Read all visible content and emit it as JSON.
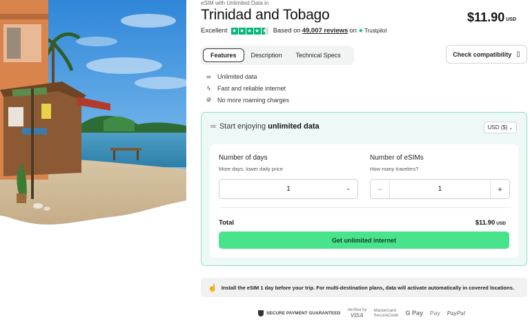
{
  "breadcrumb": "eSIM with Unlimited Data in",
  "title": "Trinidad and Tobago",
  "price": {
    "amount": "$11.90",
    "currency": "USD"
  },
  "rating": {
    "label": "Excellent",
    "stars": 4.5,
    "based_on": "Based on",
    "reviews": "49,007 reviews",
    "on": "on",
    "provider": "Trustpilot"
  },
  "tabs": [
    {
      "label": "Features",
      "active": true
    },
    {
      "label": "Description",
      "active": false
    },
    {
      "label": "Technical Specs",
      "active": false
    }
  ],
  "compat_button": "Check compatibility",
  "features": [
    {
      "icon": "infinity-icon",
      "label": "Unlimited data"
    },
    {
      "icon": "bolt-icon",
      "label": "Fast and reliable internet"
    },
    {
      "icon": "no-roaming-icon",
      "label": "No more roaming charges"
    }
  ],
  "panel": {
    "heading_prefix": "Start enjoying",
    "heading_bold": "unlimited data",
    "currency": "USD ($)",
    "days": {
      "label": "Number of days",
      "sub": "More days, lower daily price",
      "value": "1"
    },
    "esims": {
      "label": "Number of eSIMs",
      "sub": "How many travelers?",
      "value": "1"
    },
    "total_label": "Total",
    "total_value": "$11.90",
    "total_currency": "USD",
    "cta": "Get unlimited internet"
  },
  "info": "Install the eSIM 1 day before your trip. For multi-destination plans, data will activate automatically in covered locations.",
  "payments": {
    "secure": "SECURE PAYMENT GUARANTEED",
    "verified_by": "Verified by",
    "visa": "VISA",
    "mastercard": "Mastercard",
    "securecode": "SecureCode",
    "gpay": "G Pay",
    "apay": " Pay",
    "paypal": "PayPal"
  },
  "colors": {
    "accent": "#48e38a",
    "panel_bg": "#eef9f7",
    "panel_border": "#8fe0c3",
    "trustpilot": "#00b67a"
  }
}
